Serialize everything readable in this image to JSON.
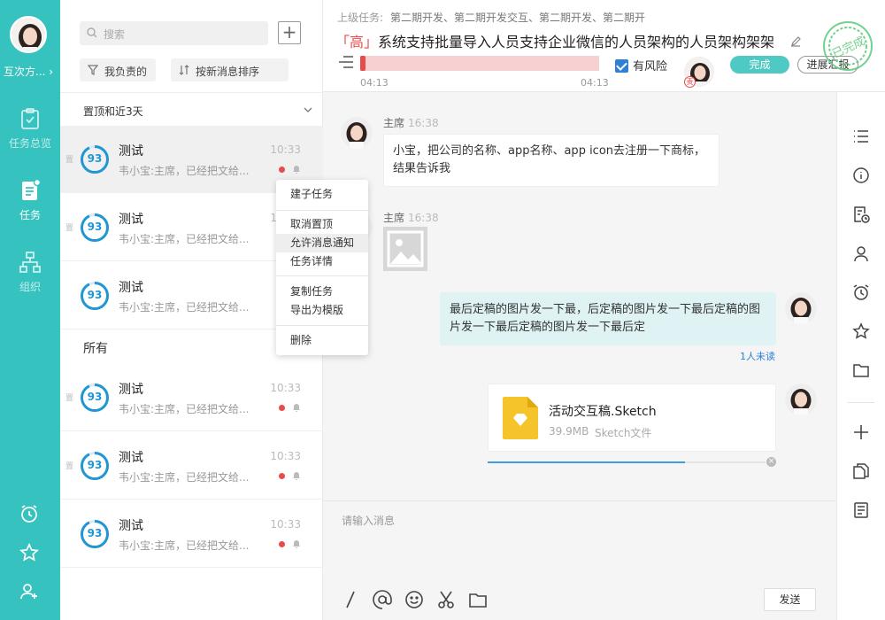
{
  "user": {
    "name": "互次方..."
  },
  "nav": [
    {
      "label": "任务总览",
      "icon": "clipboard-check-icon"
    },
    {
      "label": "任务",
      "icon": "task-list-icon"
    },
    {
      "label": "组织",
      "icon": "org-tree-icon"
    }
  ],
  "list": {
    "search_placeholder": "搜索",
    "filter_mine": "我负责的",
    "filter_sort": "按新消息排序",
    "section_pinned": "置顶和近3天",
    "section_all": "所有",
    "rows": [
      {
        "title": "测试",
        "subtitle": "韦小宝:主席，已经把文给...",
        "time": "10:33",
        "progress": "93",
        "pin": "置"
      },
      {
        "title": "测试",
        "subtitle": "韦小宝:主席，已经把文给...",
        "time": "10:33",
        "progress": "93",
        "pin": "置"
      },
      {
        "title": "测试",
        "subtitle": "韦小宝:主席，已经把文给...",
        "time": "10:33",
        "progress": "93",
        "pin": ""
      },
      {
        "title": "测试",
        "subtitle": "韦小宝:主席，已经把文给...",
        "time": "10:33",
        "progress": "93",
        "pin": "置"
      },
      {
        "title": "测试",
        "subtitle": "韦小宝:主席，已经把文给...",
        "time": "10:33",
        "progress": "93",
        "pin": "置"
      },
      {
        "title": "测试",
        "subtitle": "韦小宝:主席，已经把文给...",
        "time": "10:33",
        "progress": "93",
        "pin": ""
      }
    ]
  },
  "context_menu": {
    "items": [
      "建子任务",
      "取消置顶",
      "允许消息通知",
      "任务详情",
      "复制任务",
      "导出为模版",
      "删除"
    ]
  },
  "header": {
    "parent_label": "上级任务:",
    "parent_path": "第二期开发、第二期开发交互、第二期开发、第二期开",
    "priority": "「高」",
    "title": "系统支持批量导入人员支持企业微信的人员架构的人员架构架架",
    "progress": 0.02,
    "time_start": "04:13",
    "time_end": "04:13",
    "risk_label": "有风险",
    "avatar_badge": "责",
    "done_label": "完成",
    "report_label": "进展汇报",
    "stamp_text": "已完成"
  },
  "messages": [
    {
      "sender": "主席",
      "time": "16:38",
      "text": "小宝，把公司的名称、app名称、app icon去注册一下商标，结果告诉我"
    },
    {
      "sender": "主席",
      "time": "16:38",
      "type": "image"
    },
    {
      "text": "最后定稿的图片发一下最，后定稿的图片发一下最后定稿的图片发一下最后定稿的图片发一下最后定",
      "unread": "1人未读"
    },
    {
      "file_name": "活动交互稿.Sketch",
      "file_size": "39.9MB",
      "file_type": "Sketch文件",
      "upload_progress": 0.71
    }
  ],
  "composer": {
    "placeholder": "请输入消息",
    "send_label": "发送",
    "tools": [
      "slash-command-icon",
      "mention-icon",
      "emoji-icon",
      "scissors-icon",
      "folder-icon"
    ]
  },
  "right_toolbar": [
    "list-icon",
    "info-icon",
    "document-clock-icon",
    "user-icon",
    "alarm-icon",
    "star-icon",
    "folder-icon",
    "plus-icon",
    "copy-icon",
    "notes-icon"
  ],
  "colors": {
    "brand": "#36c3bf",
    "priority": "#e84b4b",
    "progress_ring": "#2196d3",
    "link": "#2f7fd8"
  }
}
